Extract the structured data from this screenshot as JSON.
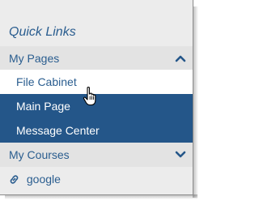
{
  "quick_links": {
    "title": "Quick Links",
    "my_pages": {
      "label": "My Pages",
      "expanded": true,
      "items": [
        {
          "label": "File Cabinet"
        },
        {
          "label": "Main Page"
        },
        {
          "label": "Message Center"
        }
      ]
    },
    "my_courses": {
      "label": "My Courses",
      "expanded": false
    },
    "links": [
      {
        "label": "google",
        "icon": "link-icon"
      }
    ]
  },
  "colors": {
    "accent": "#2a5d8f",
    "active_bg": "#245689",
    "panel_bg": "#ececec"
  },
  "cursor": {
    "icon": "hand-pointer-icon"
  }
}
